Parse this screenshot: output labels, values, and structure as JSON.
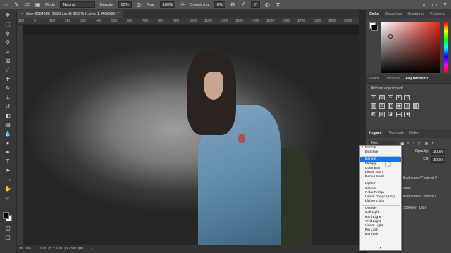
{
  "options_bar": {
    "brush_size": "125",
    "mode_label": "Mode:",
    "mode_value": "Normal",
    "opacity_label": "Opacity:",
    "opacity_value": "60%",
    "flow_label": "Flow:",
    "flow_value": "100%",
    "smoothing_label": "Smoothing:",
    "smoothing_value": "0%",
    "angle_value": "0°"
  },
  "document": {
    "tab_title": "blue-2564660_1920.jpg @ 96.8% (Layer 1, RGB/8#) *",
    "close_glyph": "×"
  },
  "ruler": {
    "ticks": [
      "100",
      "0",
      "100",
      "200",
      "300",
      "400",
      "500",
      "600",
      "700",
      "800",
      "900",
      "1000",
      "1100",
      "1200",
      "1300",
      "1400",
      "1500",
      "1600",
      "1700",
      "1800",
      "1900",
      "2000"
    ]
  },
  "status": {
    "zoom": "96.76%",
    "doc_info": "1920 px x 1280 px (300 ppi)",
    "arrow": "›"
  },
  "panels": {
    "color_tabs": [
      "Color",
      "Swatches",
      "Gradients",
      "Patterns"
    ],
    "adjust_tabs": [
      "Learn",
      "Libraries",
      "Adjustments"
    ],
    "adjust_hint": "Add an adjustment",
    "layers_tabs": [
      "Layers",
      "Channels",
      "Paths"
    ],
    "kind_label": "Kind",
    "opacity_label": "Opacity:",
    "opacity_value": "100%",
    "fill_label": "Fill:",
    "fill_value": "100%",
    "layer_rows": [
      "Brightness/Contrast 2",
      "copy",
      "Brightness/Contrast 1",
      "2564660_1920"
    ]
  },
  "blend_modes": {
    "selected": "Normal",
    "highlighted": "Darken",
    "groups": [
      [
        "Normal",
        "Dissolve"
      ],
      [
        "Darken",
        "Multiply",
        "Color Burn",
        "Linear Burn",
        "Darker Color"
      ],
      [
        "Lighten",
        "Screen",
        "Color Dodge",
        "Linear Dodge (Add)",
        "Lighter Color"
      ],
      [
        "Overlay",
        "Soft Light",
        "Hard Light",
        "Vivid Light",
        "Linear Light",
        "Pin Light",
        "Hard Mix"
      ]
    ],
    "more_arrow": "▼"
  },
  "colors": {
    "accent": "#1473e6",
    "panel_bg": "#424242",
    "app_bg": "#282828"
  }
}
